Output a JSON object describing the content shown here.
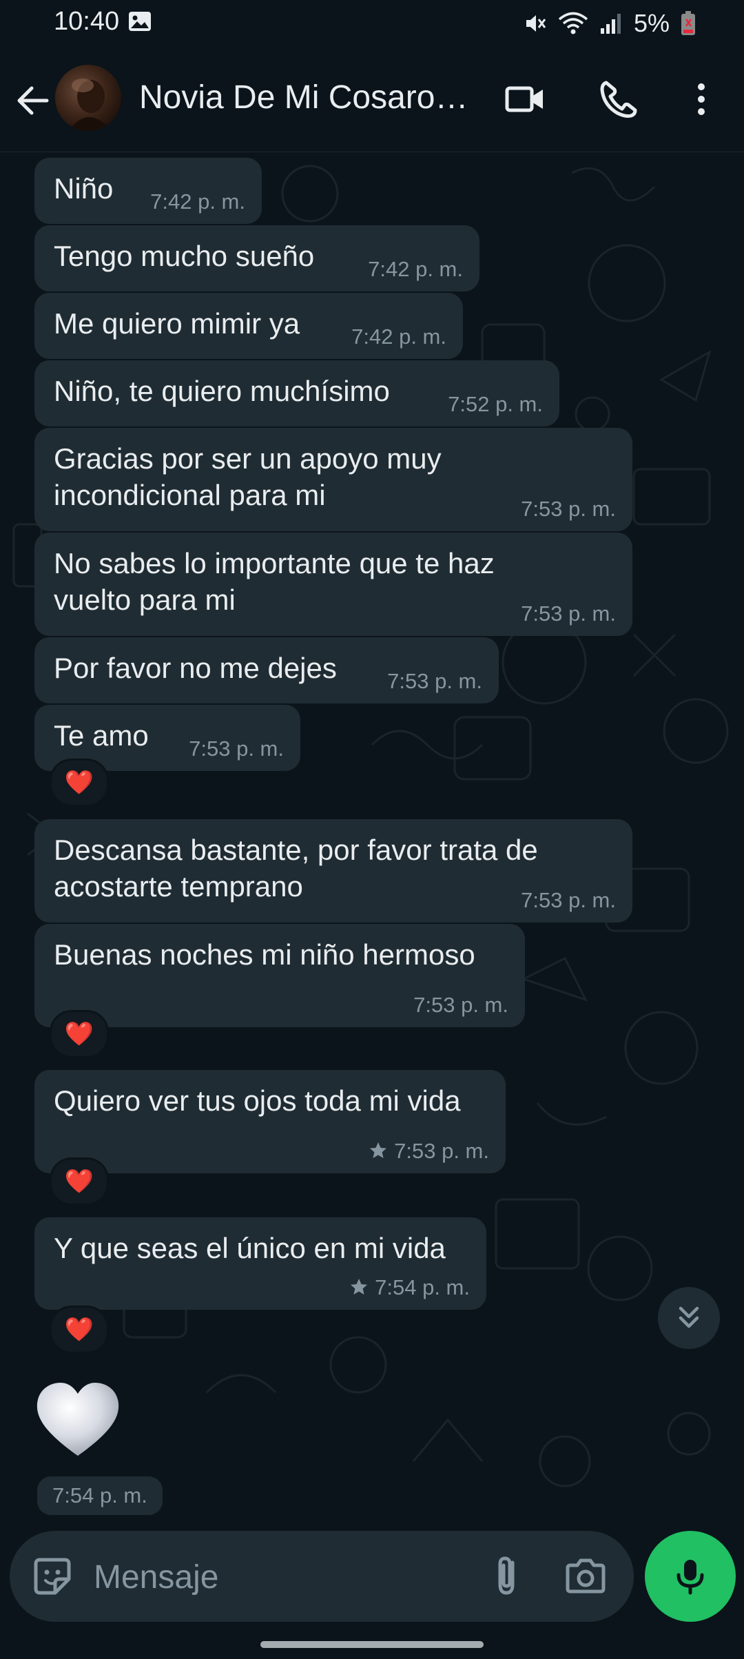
{
  "status_bar": {
    "time": "10:40",
    "battery": "5%"
  },
  "header": {
    "contact_name": "Novia De Mi Cosaron…"
  },
  "messages": [
    {
      "text": "Niño",
      "time": "7:42 p. m."
    },
    {
      "text": "Tengo mucho sueño",
      "time": "7:42 p. m."
    },
    {
      "text": "Me quiero mimir ya",
      "time": "7:42 p. m."
    },
    {
      "text": "Niño, te quiero muchísimo",
      "time": "7:52 p. m."
    },
    {
      "text": "Gracias por ser un apoyo muy incondicional para mi",
      "time": "7:53 p. m."
    },
    {
      "text": "No sabes lo importante que te haz vuelto para mi",
      "time": "7:53 p. m."
    },
    {
      "text": "Por favor no me dejes",
      "time": "7:53 p. m."
    },
    {
      "text": "Te amo",
      "time": "7:53 p. m.",
      "reaction": "❤️"
    },
    {
      "text": "Descansa bastante, por favor trata de acostarte temprano",
      "time": "7:53 p. m."
    },
    {
      "text": "Buenas noches mi niño hermoso",
      "time": "7:53 p. m.",
      "reaction": "❤️"
    },
    {
      "text": "Quiero ver tus ojos toda mi vida",
      "time": "7:53 p. m.",
      "starred": true,
      "reaction": "❤️"
    },
    {
      "text": "Y que seas el único en mi vida",
      "time": "7:54 p. m.",
      "starred": true,
      "reaction": "❤️"
    },
    {
      "text": "",
      "time": "7:54 p. m.",
      "emoji": "white-heart"
    }
  ],
  "composer": {
    "placeholder": "Mensaje"
  },
  "colors": {
    "background": "#0b141a",
    "bubble": "#202c33",
    "text": "#e9edef",
    "meta": "#8696a0",
    "accent": "#21c063",
    "reaction_heart": "#e8283c"
  },
  "icons": {
    "back": "arrow-left-icon",
    "video": "video-camera-icon",
    "call": "phone-icon",
    "menu": "more-vertical-icon",
    "emoji": "sticker-icon",
    "attach": "paperclip-icon",
    "camera": "camera-icon",
    "mic": "microphone-icon",
    "scroll": "double-chevron-down-icon",
    "star": "star-icon"
  }
}
